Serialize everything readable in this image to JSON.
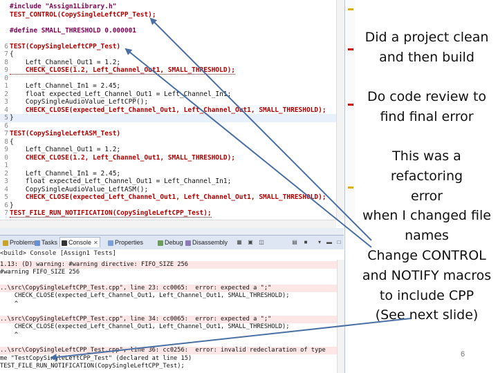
{
  "editor": {
    "lines": [
      {
        "n": "",
        "text": "#include \"Assign1Library.h\"",
        "cls": "inc"
      },
      {
        "n": "",
        "text": "TEST_CONTROL(CopySingleLeftCPP_Test);",
        "cls": "macro"
      },
      {
        "n": "",
        "text": "",
        "cls": ""
      },
      {
        "n": "",
        "text": "#define SMALL_THRESHOLD 0.000001",
        "cls": "inc"
      },
      {
        "n": "",
        "text": "",
        "cls": ""
      },
      {
        "n": "6",
        "text": "TEST(CopySingleLeftCPP_Test)",
        "cls": "macro"
      },
      {
        "n": "7",
        "text": "{",
        "cls": ""
      },
      {
        "n": "8",
        "text": "    Left_Channel_Out1 = 1.2;",
        "cls": ""
      },
      {
        "n": "9",
        "text": "    CHECK_CLOSE(1.2, Left_Channel_Out1, SMALL_THRESHOLD);",
        "cls": "macro warn"
      },
      {
        "n": "0",
        "text": "",
        "cls": ""
      },
      {
        "n": "1",
        "text": "    Left_Channel_In1 = 2.45;",
        "cls": ""
      },
      {
        "n": "2",
        "text": "    float expected_Left_Channel_Out1 = Left_Channel_In1;",
        "cls": ""
      },
      {
        "n": "3",
        "text": "    CopySingleAudioValue_LeftCPP();",
        "cls": ""
      },
      {
        "n": "4",
        "text": "    CHECK_CLOSE(expected_Left_Channel_Out1, Left_Channel_Out1, SMALL_THRESHOLD);",
        "cls": "macro warn"
      },
      {
        "n": "5",
        "text": "}",
        "cls": "hl"
      },
      {
        "n": "6",
        "text": "",
        "cls": ""
      },
      {
        "n": "7",
        "text": "TEST(CopySingleLeftASM_Test)",
        "cls": "macro"
      },
      {
        "n": "8",
        "text": "{",
        "cls": ""
      },
      {
        "n": "9",
        "text": "    Left_Channel_Out1 = 1.2;",
        "cls": ""
      },
      {
        "n": "0",
        "text": "    CHECK_CLOSE(1.2, Left_Channel_Out1, SMALL_THRESHOLD);",
        "cls": "macro"
      },
      {
        "n": "1",
        "text": "",
        "cls": ""
      },
      {
        "n": "2",
        "text": "    Left_Channel_In1 = 2.45;",
        "cls": ""
      },
      {
        "n": "3",
        "text": "    float expected_Left_Channel_Out1 = Left_Channel_In1;",
        "cls": ""
      },
      {
        "n": "4",
        "text": "    CopySingleAudioValue_LeftASM();",
        "cls": ""
      },
      {
        "n": "5",
        "text": "    CHECK_CLOSE(expected_Left_Channel_Out1, Left_Channel_Out1, SMALL_THRESHOLD);",
        "cls": "macro"
      },
      {
        "n": "6",
        "text": "}",
        "cls": ""
      },
      {
        "n": "7",
        "text": "TEST_FILE_RUN_NOTIFICATION(CopySingleLeftCPP_Test);",
        "cls": "macro warn"
      }
    ]
  },
  "tabs": [
    {
      "label": "Problems",
      "color": "#c9a227"
    },
    {
      "label": "Tasks",
      "color": "#6a8ed0"
    },
    {
      "label": "Console",
      "color": "#333333",
      "active": true
    },
    {
      "label": "Properties",
      "color": "#7aa0d6"
    },
    {
      "label": "Debug",
      "color": "#6a9e5a"
    },
    {
      "label": "Disassembly",
      "color": "#8a7ab8"
    }
  ],
  "console": {
    "header": "<build> Console [Assign1 Tests]",
    "lines": [
      {
        "text": "1.13: (D) warning: #warning directive: FIFO_SIZE 256",
        "err": true
      },
      {
        "text": "#warning FIFO_SIZE 256",
        "err": false
      },
      {
        "text": "",
        "err": false
      },
      {
        "text": "..\\src\\CopySingleLeftCPP_Test.cpp\", line 23: cc0065:  error: expected a \";\"",
        "err": true
      },
      {
        "text": "    CHECK_CLOSE(expected_Left_Channel_Out1, Left_Channel_Out1, SMALL_THRESHOLD);",
        "err": false
      },
      {
        "text": "    ^",
        "err": false
      },
      {
        "text": "",
        "err": false
      },
      {
        "text": "..\\src\\CopySingleLeftCPP_Test.cpp\", line 34: cc0065:  error: expected a \";\"",
        "err": true
      },
      {
        "text": "    CHECK_CLOSE(expected_Left_Channel_Out1, Left_Channel_Out1, SMALL_THRESHOLD);",
        "err": false
      },
      {
        "text": "    ^",
        "err": false
      },
      {
        "text": "",
        "err": false
      },
      {
        "text": "..\\src\\CopySingleLeftCPP_Test.cpp\", line 36: cc0256:  error: invalid redeclaration of type",
        "err": true
      },
      {
        "text": "me \"TestCopySingleLeftCPP_Test\" (declared at line 15)",
        "err": false
      },
      {
        "text": "TEST_FILE_RUN_NOTIFICATION(CopySingleLeftCPP_Test);",
        "err": false
      }
    ]
  },
  "notes": [
    {
      "text": "Did a project clean and then build",
      "lines": [
        "Did a project clean",
        "and then build"
      ]
    },
    {
      "text": "Do code review to find final error",
      "lines": [
        "Do code review to",
        "find final error"
      ]
    },
    {
      "text": "This was a refactoring error when I changed file names Change CONTROL and NOTIFY macros to include CPP (See next slide)",
      "lines": [
        "This was a",
        "refactoring",
        "error",
        "when I changed file",
        "names",
        "Change CONTROL",
        "and NOTIFY macros",
        "to include CPP",
        "(See next slide)"
      ]
    }
  ],
  "page_number": "6",
  "colors": {
    "arrow": "#4a6fa5",
    "error_bg": "#fde6e6",
    "macro": "#b00000"
  }
}
